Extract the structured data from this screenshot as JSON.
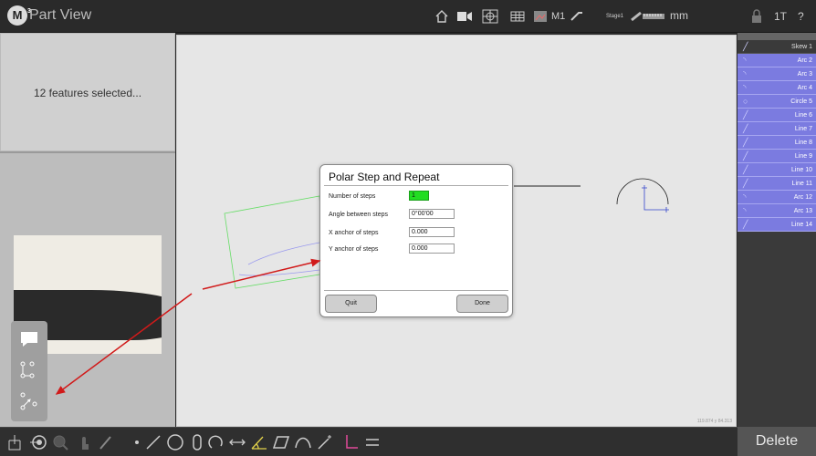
{
  "titlebar": {
    "app_title": "Part View",
    "logo": "M",
    "logo_sup": "3",
    "stage_label": "Stage1",
    "mode_label": "M1",
    "unit": "mm",
    "count_label": "1T",
    "help": "?",
    "icons": [
      "home-icon",
      "video-icon",
      "crosshair-icon",
      "grid-icon",
      "image-icon",
      "probe-icon",
      "ruler-icon",
      "lock-icon"
    ]
  },
  "left_panel": {
    "selection_text": "12 features selected..."
  },
  "dialog": {
    "title": "Polar Step and Repeat",
    "fields": [
      {
        "label": "Number of steps",
        "value": "1"
      },
      {
        "label": "Angle between steps",
        "value": "0°00'00"
      },
      {
        "label": "X anchor of steps",
        "value": "0.000"
      },
      {
        "label": "Y anchor of steps",
        "value": "0.000"
      }
    ],
    "quit_label": "Quit",
    "done_label": "Done"
  },
  "canvas": {
    "coords": "119.874 y 84.313"
  },
  "feature_list": [
    {
      "label": "Skew 1",
      "icon": "line-icon",
      "selected": false
    },
    {
      "label": "Arc 2",
      "icon": "arc-icon",
      "selected": true
    },
    {
      "label": "Arc 3",
      "icon": "arc-icon",
      "selected": true
    },
    {
      "label": "Arc 4",
      "icon": "arc-icon",
      "selected": true
    },
    {
      "label": "Circle 5",
      "icon": "circle-icon",
      "selected": true
    },
    {
      "label": "Line 6",
      "icon": "line-icon",
      "selected": true
    },
    {
      "label": "Line 7",
      "icon": "line-icon",
      "selected": true
    },
    {
      "label": "Line 8",
      "icon": "line-icon",
      "selected": true
    },
    {
      "label": "Line 9",
      "icon": "line-icon",
      "selected": true
    },
    {
      "label": "Line 10",
      "icon": "line-icon",
      "selected": true
    },
    {
      "label": "Line 11",
      "icon": "line-icon",
      "selected": true
    },
    {
      "label": "Arc 12",
      "icon": "arc-icon",
      "selected": true
    },
    {
      "label": "Arc 13",
      "icon": "arc-icon",
      "selected": true
    },
    {
      "label": "Line 14",
      "icon": "line-icon",
      "selected": true
    }
  ],
  "bottombar": {
    "delete_label": "Delete",
    "icons": [
      "datum-icon",
      "target-icon",
      "search-icon",
      "touch-icon",
      "pen-icon",
      "point-icon",
      "line-icon",
      "circle-icon",
      "slot-icon",
      "arc-icon",
      "distance-icon",
      "angle-icon",
      "parallelogram-icon",
      "curve-icon",
      "wand-icon",
      "perpendicular-icon",
      "equal-icon"
    ]
  },
  "colors": {
    "selection": "#7b7be0",
    "annotation_arrow": "#d11a1a",
    "green_field": "#22dd22"
  }
}
